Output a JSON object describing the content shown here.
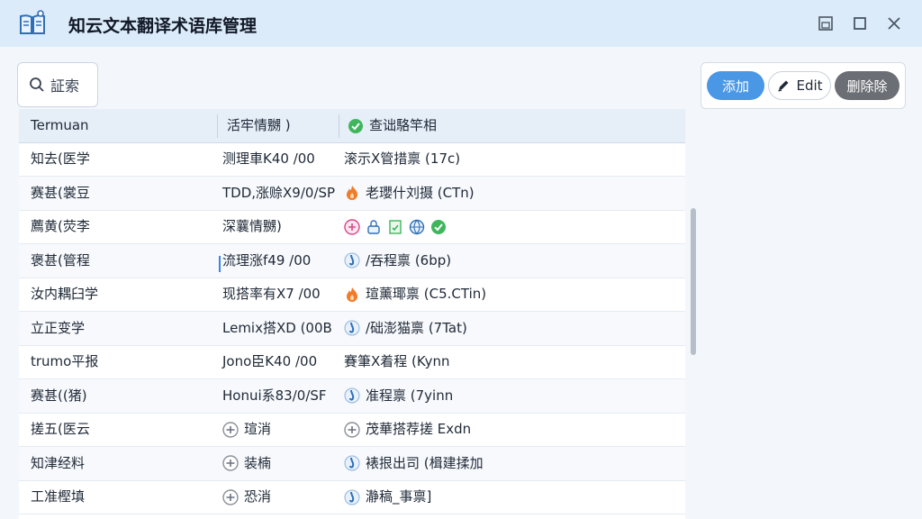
{
  "window": {
    "title": "知云文本翻译术语库管理",
    "icon": "book-icon",
    "controls": [
      "restore-icon",
      "maximize-icon",
      "close-icon"
    ]
  },
  "search": {
    "label": "証索",
    "icon": "search-icon"
  },
  "actions": {
    "add_label": "添加",
    "edit_label": "Edit",
    "delete_label": "删除除"
  },
  "table": {
    "headers": [
      "Termuan",
      "活牢情嬲 )",
      "查诎駱竿相"
    ],
    "rows": [
      {
        "c1": "知去(医学",
        "c2": "测理車K40 /00",
        "c3": "滚示X管措禀 (17c)",
        "icon": ""
      },
      {
        "c1": "赛甚(裳豆",
        "c2": "TDD,涨赊X9/0/SP",
        "c3": "老瓔什刘摄 (CTn)",
        "icon": "flame-icon"
      },
      {
        "c1": "薦黄(荧李",
        "c2": "深蘘情嬲)",
        "c3": "",
        "icon": "multi-status-icons"
      },
      {
        "c1": "褒甚(管程",
        "c2": "流理涨f49 /00",
        "c3": "/吞程禀 (6bp)",
        "icon": "drop-icon"
      },
      {
        "c1": "汝内耦臼学",
        "c2": "现搭率有X7 /00",
        "c3": "瑄薰瑘禀 (C5.CTin)",
        "icon": "flame-icon"
      },
      {
        "c1": "立正变学",
        "c2": "Lemix搭XD (00B",
        "c3": "/础澎猫禀 (7Tat)",
        "icon": "drop-icon"
      },
      {
        "c1": "trumo平报",
        "c2": "Jono臣K40 /00",
        "c3": "賽筆X着程 (Kynn",
        "icon": ""
      },
      {
        "c1": "赛甚((猪)",
        "c2": "Honui系83/0/SF",
        "c3": "准程禀 (7yinn",
        "icon": "drop-icon"
      },
      {
        "c1": "搓五(医云",
        "c2": "瑄消",
        "c3": "茂華搭荐搓 Exdn",
        "icon": "pending-icon",
        "c2icon": "pending-icon"
      },
      {
        "c1": "知津经料",
        "c2": "装楠",
        "c3": "裱拫出司 (楫建揉加",
        "icon": "drop-icon",
        "c2icon": "pending-icon"
      },
      {
        "c1": "工准樫填",
        "c2": "恐消",
        "c3": "瀞稿_事禀]",
        "icon": "drop-icon",
        "c2icon": "pending-icon"
      }
    ]
  },
  "colors": {
    "titlebar": "#dcebfa",
    "accent": "#4a97e6",
    "delete": "#6b6f75",
    "success": "#3fb65c",
    "warning": "#f07c2a"
  }
}
